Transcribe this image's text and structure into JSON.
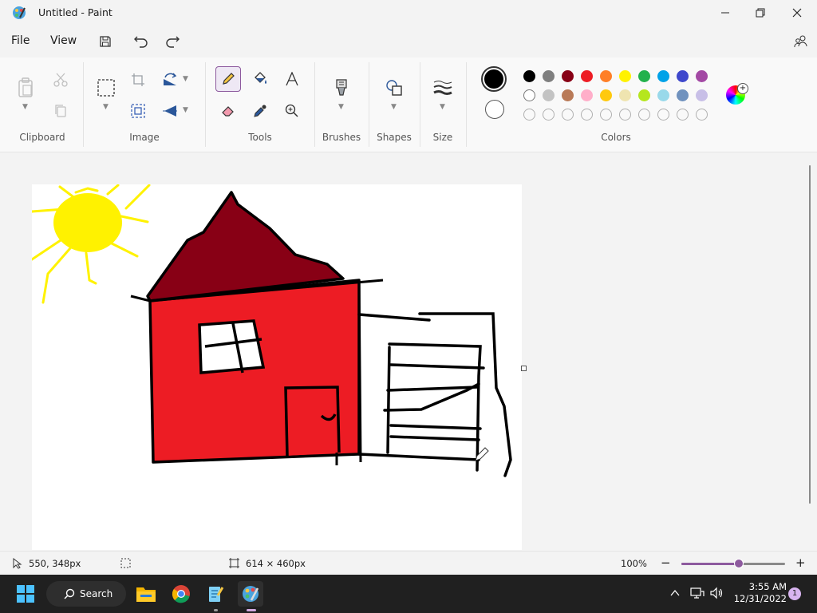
{
  "window": {
    "title": "Untitled - Paint"
  },
  "menu": {
    "file": "File",
    "view": "View"
  },
  "ribbon": {
    "groups": {
      "clipboard": "Clipboard",
      "image": "Image",
      "tools": "Tools",
      "brushes": "Brushes",
      "shapes": "Shapes",
      "size": "Size",
      "colors": "Colors"
    },
    "palette": {
      "row1": [
        "#000000",
        "#7f7f7f",
        "#880015",
        "#ed1c24",
        "#ff7f27",
        "#fff200",
        "#22b14c",
        "#00a2e8",
        "#3f48cc",
        "#a349a4"
      ],
      "row2": [
        "#ffffff",
        "#c3c3c3",
        "#b97a57",
        "#ffaec9",
        "#ffc90e",
        "#efe4b0",
        "#b5e61d",
        "#99d9ea",
        "#7092be",
        "#c8bfe7"
      ],
      "row3": [
        "",
        "",
        "",
        "",
        "",
        "",
        "",
        "",
        "",
        ""
      ]
    },
    "primary_color": "#000000",
    "secondary_color": "#ffffff"
  },
  "status": {
    "cursor_position": "550, 348px",
    "canvas_size": "614 × 460px",
    "zoom": "100%",
    "zoom_level": 0.55
  },
  "taskbar": {
    "search_label": "Search",
    "time": "3:55 AM",
    "date": "12/31/2022",
    "notification_count": "1"
  }
}
